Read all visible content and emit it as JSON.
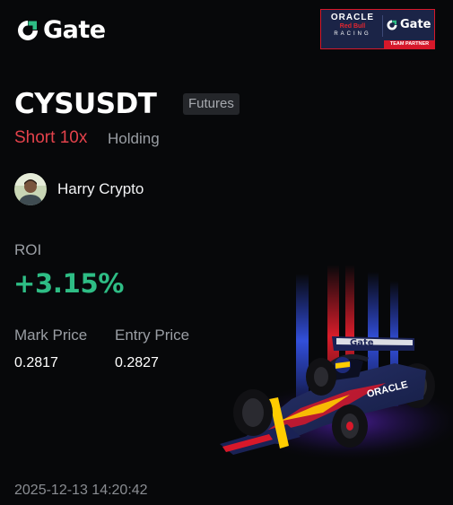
{
  "brand": {
    "name": "Gate",
    "icon": "gate-logo-icon"
  },
  "sponsor": {
    "oracle": "ORACLE",
    "redbull": "Red Bull",
    "racing": "RACING",
    "partner": "Gate",
    "strip": "TEAM PARTNER"
  },
  "position": {
    "pair": "CYSUSDT",
    "market_type": "Futures",
    "direction": "Short 10x",
    "status": "Holding"
  },
  "user": {
    "name": "Harry Crypto",
    "avatar_icon": "user-avatar"
  },
  "stats": {
    "roi_label": "ROI",
    "roi_value": "+3.15%",
    "mark_price_label": "Mark Price",
    "mark_price": "0.2817",
    "entry_price_label": "Entry Price",
    "entry_price": "0.2827"
  },
  "timestamp": "2025-12-13 14:20:42",
  "artwork": {
    "car_livery": "Gate",
    "car_icon": "f1-car-illustration"
  },
  "colors": {
    "background": "#07080a",
    "profit": "#2ebd85",
    "short": "#e3424b",
    "muted": "#9a9ea4",
    "tag_bg": "#24262a",
    "brand_blue": "#1f6fff",
    "brand_green": "#2ebd85"
  }
}
